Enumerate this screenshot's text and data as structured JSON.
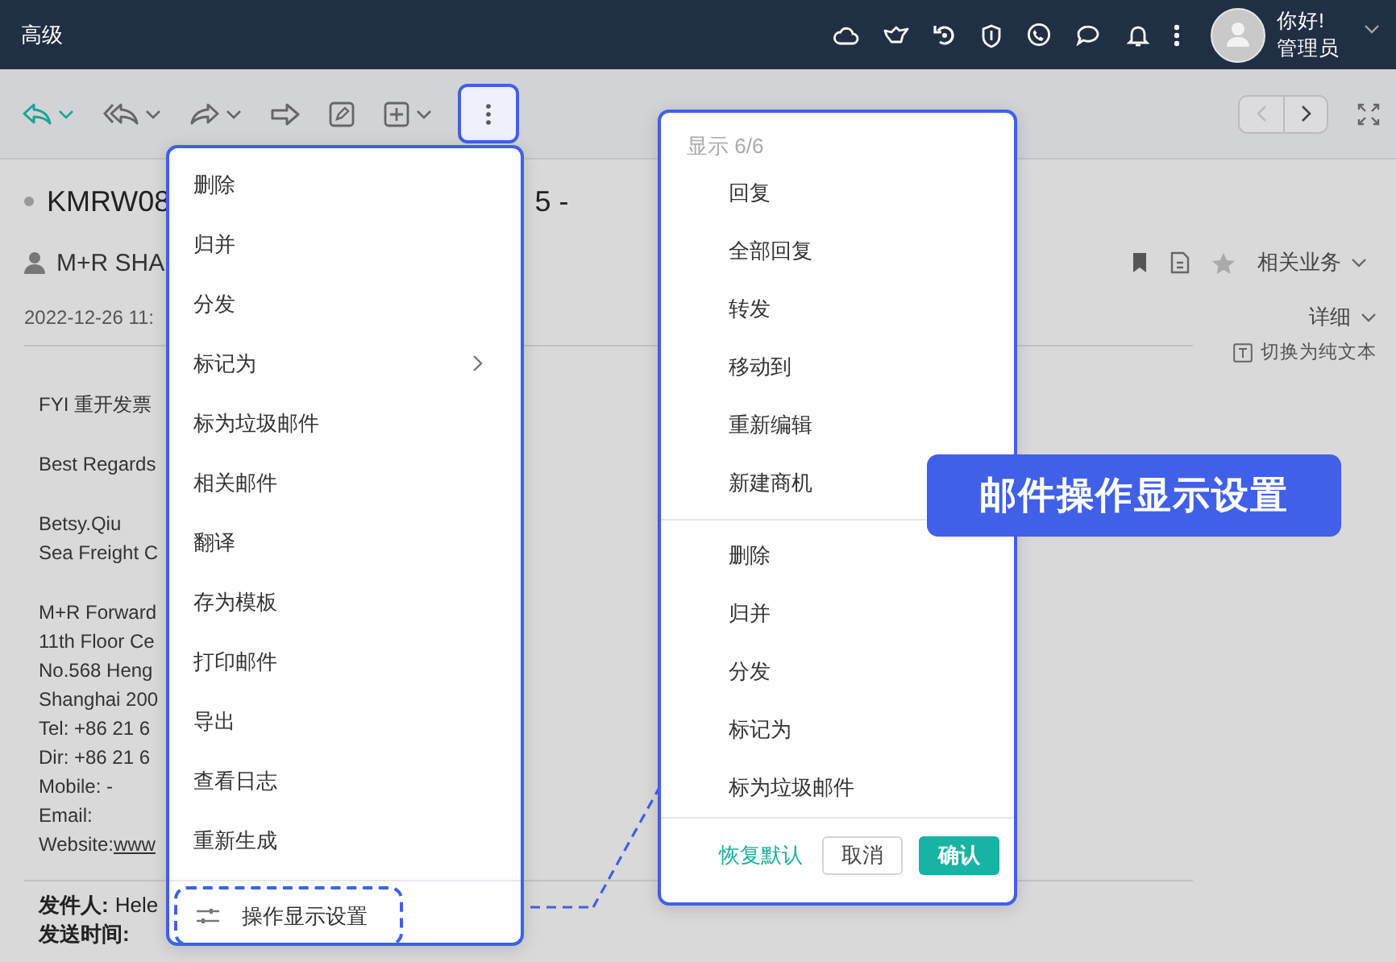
{
  "topbar": {
    "title": "高级",
    "greeting": "你好!",
    "user": "管理员"
  },
  "toolbar": {
    "buttons": [
      {
        "kind": "reply",
        "caret": true,
        "highlighted": false
      },
      {
        "kind": "reply-all",
        "caret": true,
        "highlighted": false
      },
      {
        "kind": "forward",
        "caret": true,
        "highlighted": false
      },
      {
        "kind": "move",
        "caret": false,
        "highlighted": false
      },
      {
        "kind": "edit",
        "caret": false,
        "highlighted": false
      },
      {
        "kind": "add",
        "caret": true,
        "highlighted": false
      },
      {
        "kind": "more",
        "caret": false,
        "highlighted": true
      }
    ]
  },
  "email": {
    "subject_start": "KMRW08",
    "subject_end": "5 -",
    "sender": "M+R SHA",
    "date": "2022-12-26 11:",
    "related": "相关业务",
    "detail": "详细",
    "plain_text": "切换为纯文本",
    "paragraphs": [
      [
        "FYI 重开发票"
      ],
      [
        "Best Regards"
      ],
      [
        "Betsy.Qiu",
        "Sea Freight C"
      ],
      [
        "M+R Forward",
        "11th Floor Ce",
        "No.568 Heng",
        "Shanghai 200",
        "Tel: +86 21 6",
        "Dir: +86 21 6",
        "Mobile: -",
        "Email:"
      ]
    ],
    "website": {
      "label": "Website:",
      "link": "www"
    },
    "from_label": "发件人:",
    "from": "Hele",
    "sent_label": "发送时间:"
  },
  "more_menu": {
    "items": [
      {
        "label": "删除",
        "submenu": false
      },
      {
        "label": "归并",
        "submenu": false
      },
      {
        "label": "分发",
        "submenu": false
      },
      {
        "label": "标记为",
        "submenu": true
      },
      {
        "label": "标为垃圾邮件",
        "submenu": false
      },
      {
        "label": "相关邮件",
        "submenu": false
      },
      {
        "label": "翻译",
        "submenu": false
      },
      {
        "label": "存为模板",
        "submenu": false
      },
      {
        "label": "打印邮件",
        "submenu": false
      },
      {
        "label": "导出",
        "submenu": false
      },
      {
        "label": "查看日志",
        "submenu": false
      },
      {
        "label": "重新生成",
        "submenu": false
      }
    ],
    "footer": "操作显示设置"
  },
  "display_panel": {
    "header": "显示 6/6",
    "groups": [
      [
        "回复",
        "全部回复",
        "转发",
        "移动到",
        "重新编辑",
        "新建商机"
      ],
      [
        "删除",
        "归并",
        "分发",
        "标记为",
        "标为垃圾邮件"
      ]
    ],
    "reset": "恢复默认",
    "cancel": "取消",
    "confirm": "确认"
  },
  "callout": "邮件操作显示设置"
}
